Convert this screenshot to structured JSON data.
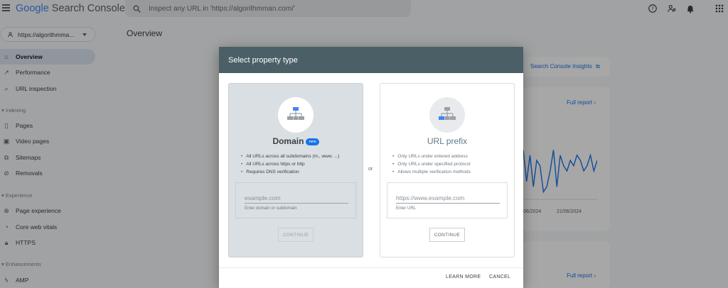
{
  "app": {
    "logo_google": "Google",
    "logo_product": "Search Console",
    "search_placeholder": "Inspect any URL in 'https://algorithmman.com/'"
  },
  "sidebar": {
    "property": "https://algorithmma...",
    "items": [
      {
        "label": "Overview",
        "icon": "home-icon",
        "active": true
      },
      {
        "label": "Performance",
        "icon": "trending-up-icon"
      },
      {
        "label": "URL inspection",
        "icon": "search-icon"
      }
    ],
    "indexing": {
      "label": "Indexing",
      "items": [
        {
          "label": "Pages",
          "icon": "pages-icon"
        },
        {
          "label": "Video pages",
          "icon": "video-pages-icon"
        },
        {
          "label": "Sitemaps",
          "icon": "sitemap-icon"
        },
        {
          "label": "Removals",
          "icon": "removals-icon"
        }
      ]
    },
    "experience": {
      "label": "Experience",
      "items": [
        {
          "label": "Page experience",
          "icon": "page-experience-icon"
        },
        {
          "label": "Core web vitals",
          "icon": "speed-icon"
        },
        {
          "label": "HTTPS",
          "icon": "lock-icon"
        }
      ]
    },
    "enhancements": {
      "label": "Enhancements",
      "items": [
        {
          "label": "AMP",
          "icon": "bolt-icon"
        }
      ]
    }
  },
  "main": {
    "title": "Overview",
    "insights_link": "Search Console Insights",
    "full_report": "Full report",
    "chart_dates": [
      "06/2024",
      "21/06/2024"
    ],
    "chart_values": [
      9,
      3,
      8,
      2,
      7,
      6,
      1,
      2,
      5,
      9,
      2,
      8,
      6,
      5,
      7,
      6,
      8,
      7,
      5,
      6,
      8,
      5,
      7
    ]
  },
  "dialog": {
    "title": "Select property type",
    "or_label": "or",
    "domain": {
      "title": "Domain",
      "badge": "new",
      "bullets": [
        "All URLs across all subdomains (m., www. ...)",
        "All URLs across https or http",
        "Requires DNS verification"
      ],
      "placeholder": "example.com",
      "hint": "Enter domain or subdomain",
      "continue": "CONTINUE"
    },
    "url_prefix": {
      "title": "URL prefix",
      "bullets": [
        "Only URLs under entered address",
        "Only URLs under specified protocol",
        "Allows multiple verification methods"
      ],
      "placeholder": "https://www.example.com",
      "hint": "Enter URL",
      "continue": "CONTINUE"
    },
    "learn_more": "LEARN MORE",
    "cancel": "CANCEL"
  },
  "colors": {
    "dialog_header": "#4a5f66",
    "link_blue": "#1a73e8",
    "active_nav": "#dbe4f0",
    "scrim": "rgba(0,0,0,0.34)"
  }
}
